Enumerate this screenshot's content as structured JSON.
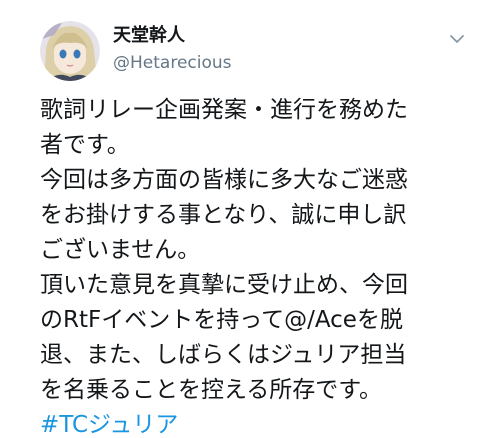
{
  "user": {
    "display_name": "天堂幹人",
    "handle": "@Hetarecious",
    "avatar_icon": "avatar-anime-character-icon"
  },
  "menu": {
    "icon": "chevron-down-icon"
  },
  "tweet": {
    "lines": [
      "歌詞リレー企画発案・進行を務めた",
      "者です。",
      "今回は多方面の皆様に多大なご迷惑",
      "をお掛けする事となり、誠に申し訳",
      "ございません。",
      "頂いた意見を真摯に受け止め、今回",
      "のRtFイベントを持って@/Aceを脱",
      "退、また、しばらくはジュリア担当",
      "を名乗ることを控える所存です。"
    ],
    "hashtag": "#TCジュリア"
  },
  "colors": {
    "text": "#14171a",
    "secondary": "#657786",
    "link": "#1b95e0"
  }
}
